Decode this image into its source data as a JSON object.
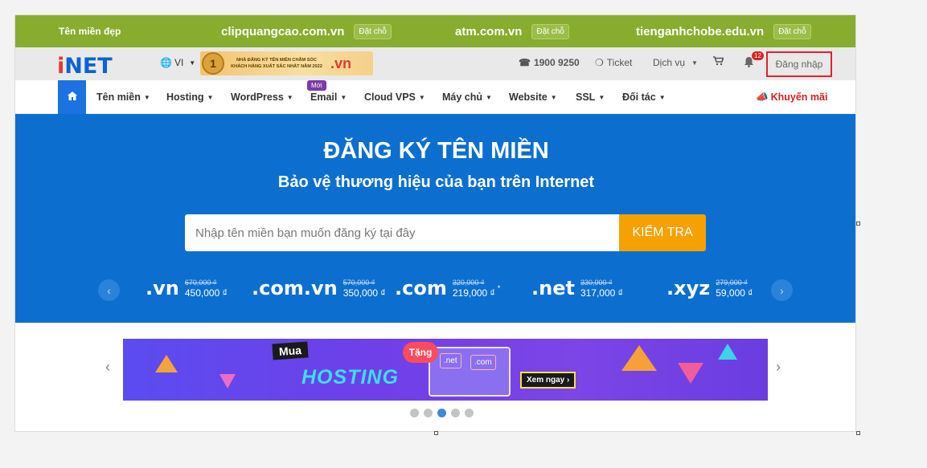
{
  "promo_bar": {
    "label": "Tên miền đẹp",
    "button": "Đặt chỗ",
    "domains": [
      "clipquangcao.com.vn",
      "atm.com.vn",
      "tienganhchobe.edu.vn"
    ]
  },
  "header": {
    "logo": "iNET",
    "language": "VI",
    "award": {
      "rank": "1",
      "text": "NHÀ ĐĂNG KÝ TÊN MIỀN CHĂM SÓC KHÁCH HÀNG XUẤT SẮC NHẤT NĂM 2022",
      "brand": ".vn"
    },
    "hotline": "1900 9250",
    "ticket": "Ticket",
    "services": "Dịch vụ",
    "notifications_count": "12",
    "login": "Đăng nhập"
  },
  "nav": {
    "items": [
      "Tên miền",
      "Hosting",
      "WordPress",
      "Email",
      "Cloud VPS",
      "Máy chủ",
      "Website",
      "SSL",
      "Đối tác"
    ],
    "new_badge": "Mới",
    "promotion": "Khuyến mãi"
  },
  "hero": {
    "title": "ĐĂNG KÝ TÊN MIỀN",
    "subtitle": "Bảo vệ thương hiệu của bạn trên Internet",
    "search_placeholder": "Nhập tên miền bạn muốn đăng ký tại đây",
    "search_button": "KIỂM TRA",
    "tlds": [
      {
        "name": ".vn",
        "old": "670,000 ₫",
        "new": "450,000 ₫"
      },
      {
        "name": ".com.vn",
        "old": "570,000 ₫",
        "new": "350,000 ₫"
      },
      {
        "name": ".com",
        "old": "320,000 ₫",
        "new": "219,000 ₫",
        "note": "*"
      },
      {
        "name": ".net",
        "old": "330,000 ₫",
        "new": "317,000 ₫"
      },
      {
        "name": ".xyz",
        "old": "279,000 ₫",
        "new": "59,000 ₫"
      }
    ]
  },
  "banner": {
    "mua": "Mua",
    "hosting": "HOSTING",
    "tang": "Tặng",
    "net": ".net",
    "com": ".com",
    "cta": "Xem ngay"
  },
  "slider": {
    "dots": 5,
    "active_index": 2
  },
  "colors": {
    "promo_green": "#88ad2e",
    "primary_blue": "#0c6fd0",
    "search_orange": "#f6a100",
    "login_border": "#e0222a"
  }
}
